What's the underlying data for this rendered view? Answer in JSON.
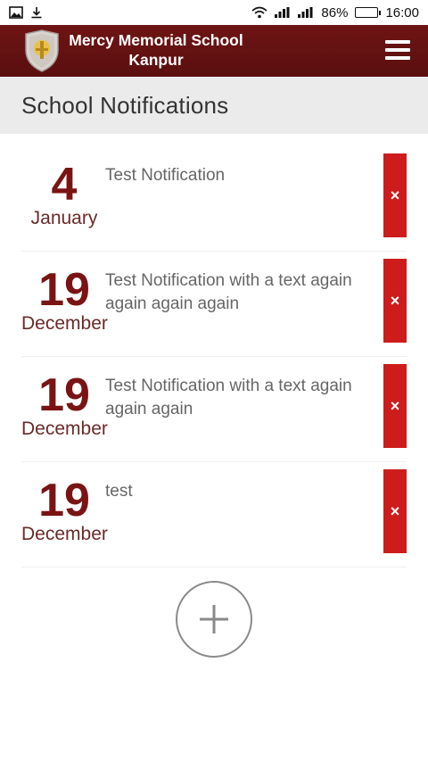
{
  "status_bar": {
    "left_icons": [
      "image-icon",
      "download-icon"
    ],
    "battery_percent": "86%",
    "battery_level": 0.86,
    "time": "16:00"
  },
  "app_bar": {
    "school_name_line1": "Mercy Memorial School",
    "school_name_line2": "Kanpur",
    "background_color": "#5e1010"
  },
  "page": {
    "title": "School Notifications"
  },
  "notifications": [
    {
      "day": "4",
      "month": "January",
      "text": "Test Notification",
      "delete_label": "×"
    },
    {
      "day": "19",
      "month": "December",
      "text": "Test Notification with a text again again again again",
      "delete_label": "×"
    },
    {
      "day": "19",
      "month": "December",
      "text": "Test Notification with a text again again again",
      "delete_label": "×"
    },
    {
      "day": "19",
      "month": "December",
      "text": "test",
      "delete_label": "×"
    }
  ],
  "colors": {
    "accent_red": "#cc1c1c",
    "date_red": "#7a1414",
    "header_gray": "#ebebeb"
  }
}
